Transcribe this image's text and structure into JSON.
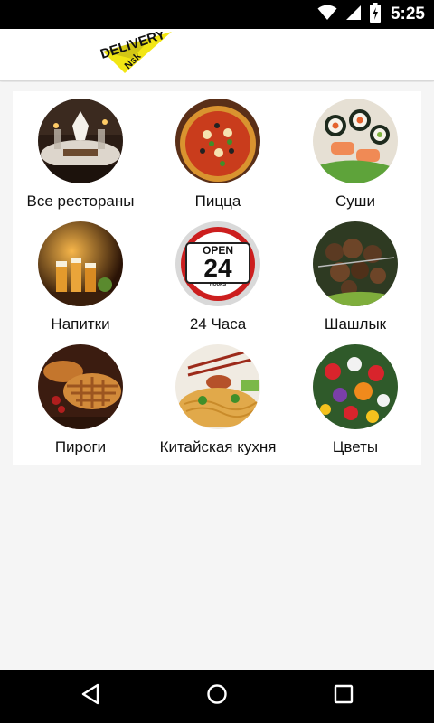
{
  "status_bar": {
    "time": "5:25",
    "icons": [
      "wifi-icon",
      "signal-icon",
      "battery-charging-icon"
    ]
  },
  "header": {
    "logo_text": "DELIVERY",
    "logo_subtext": "Nsk"
  },
  "categories": [
    {
      "label": "Все рестораны",
      "icon": "restaurant-table-photo"
    },
    {
      "label": "Пицца",
      "icon": "pizza-photo"
    },
    {
      "label": "Суши",
      "icon": "sushi-photo"
    },
    {
      "label": "Напитки",
      "icon": "beer-drinks-photo"
    },
    {
      "label": "24 Часа",
      "icon": "open-24-hours-sign",
      "sign_top": "OPEN",
      "sign_number": "24",
      "sign_bottom": "HOURS"
    },
    {
      "label": "Шашлык",
      "icon": "shashlik-photo"
    },
    {
      "label": "Пироги",
      "icon": "pie-photo"
    },
    {
      "label": "Китайская кухня",
      "icon": "chinese-noodles-photo"
    },
    {
      "label": "Цветы",
      "icon": "flowers-photo"
    }
  ],
  "nav_bar": {
    "buttons": [
      "back-icon",
      "home-icon",
      "recents-icon"
    ]
  },
  "colors": {
    "status_bar": "#000000",
    "app_bar": "#ffffff",
    "background": "#f5f5f5",
    "logo_yellow": "#f2e614",
    "sign_red": "#cc1e1e"
  }
}
